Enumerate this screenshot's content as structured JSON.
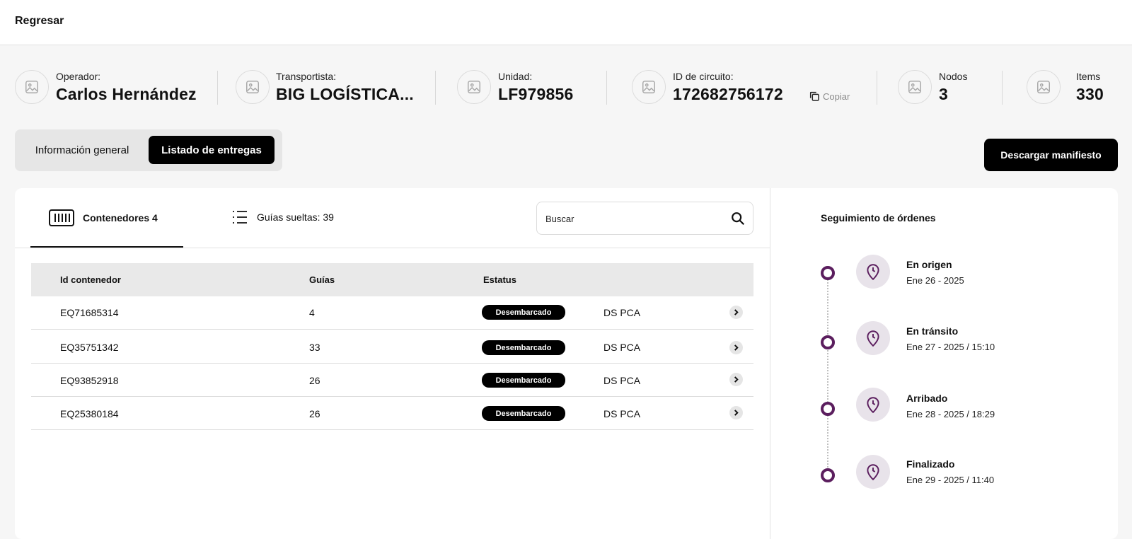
{
  "topbar": {
    "back_label": "Regresar"
  },
  "stats": {
    "operator": {
      "label": "Operador:",
      "value": "Carlos Hernández"
    },
    "carrier": {
      "label": "Transportista:",
      "value": "BIG LOGÍSTICA..."
    },
    "unit": {
      "label": "Unidad:",
      "value": "LF979856"
    },
    "circuit": {
      "label": "ID de circuito:",
      "value": "172682756172",
      "copy_label": "Copiar"
    },
    "nodes": {
      "label": "Nodos",
      "value": "3"
    },
    "items": {
      "label": "Items",
      "value": "330"
    }
  },
  "tabs": {
    "general": "Información general",
    "deliveries": "Listado de entregas",
    "active": "deliveries"
  },
  "actions": {
    "download": "Descargar manifiesto"
  },
  "subtabs": {
    "containers": "Contenedores 4",
    "loose_guides": "Guías sueltas: 39",
    "active": "containers"
  },
  "search": {
    "placeholder": "Buscar"
  },
  "table": {
    "headers": {
      "id": "Id contenedor",
      "guides": "Guías",
      "status": "Estatus"
    },
    "rows": [
      {
        "id": "EQ71685314",
        "guides": "4",
        "status": "Desembarcado",
        "location": "DS PCA"
      },
      {
        "id": "EQ35751342",
        "guides": "33",
        "status": "Desembarcado",
        "location": "DS PCA"
      },
      {
        "id": "EQ93852918",
        "guides": "26",
        "status": "Desembarcado",
        "location": "DS PCA"
      },
      {
        "id": "EQ25380184",
        "guides": "26",
        "status": "Desembarcado",
        "location": "DS PCA"
      }
    ]
  },
  "tracking": {
    "title": "Seguimiento de órdenes",
    "steps": [
      {
        "title": "En origen",
        "date": "Ene 26 - 2025"
      },
      {
        "title": "En tránsito",
        "date": "Ene 27 - 2025 / 15:10"
      },
      {
        "title": "Arribado",
        "date": "Ene 28 - 2025 / 18:29"
      },
      {
        "title": "Finalizado",
        "date": "Ene 29 - 2025 / 11:40"
      }
    ]
  },
  "colors": {
    "accent": "#5b1e5e",
    "accent_bg": "#e8e3ea",
    "primary": "#000000"
  },
  "icons": {
    "stat": "image-placeholder-icon",
    "copy": "copy-icon",
    "containers": "barcode-icon",
    "guides": "list-icon",
    "search": "search-icon",
    "row": "chevron-right-icon",
    "timeline": "location-clock-icon"
  }
}
